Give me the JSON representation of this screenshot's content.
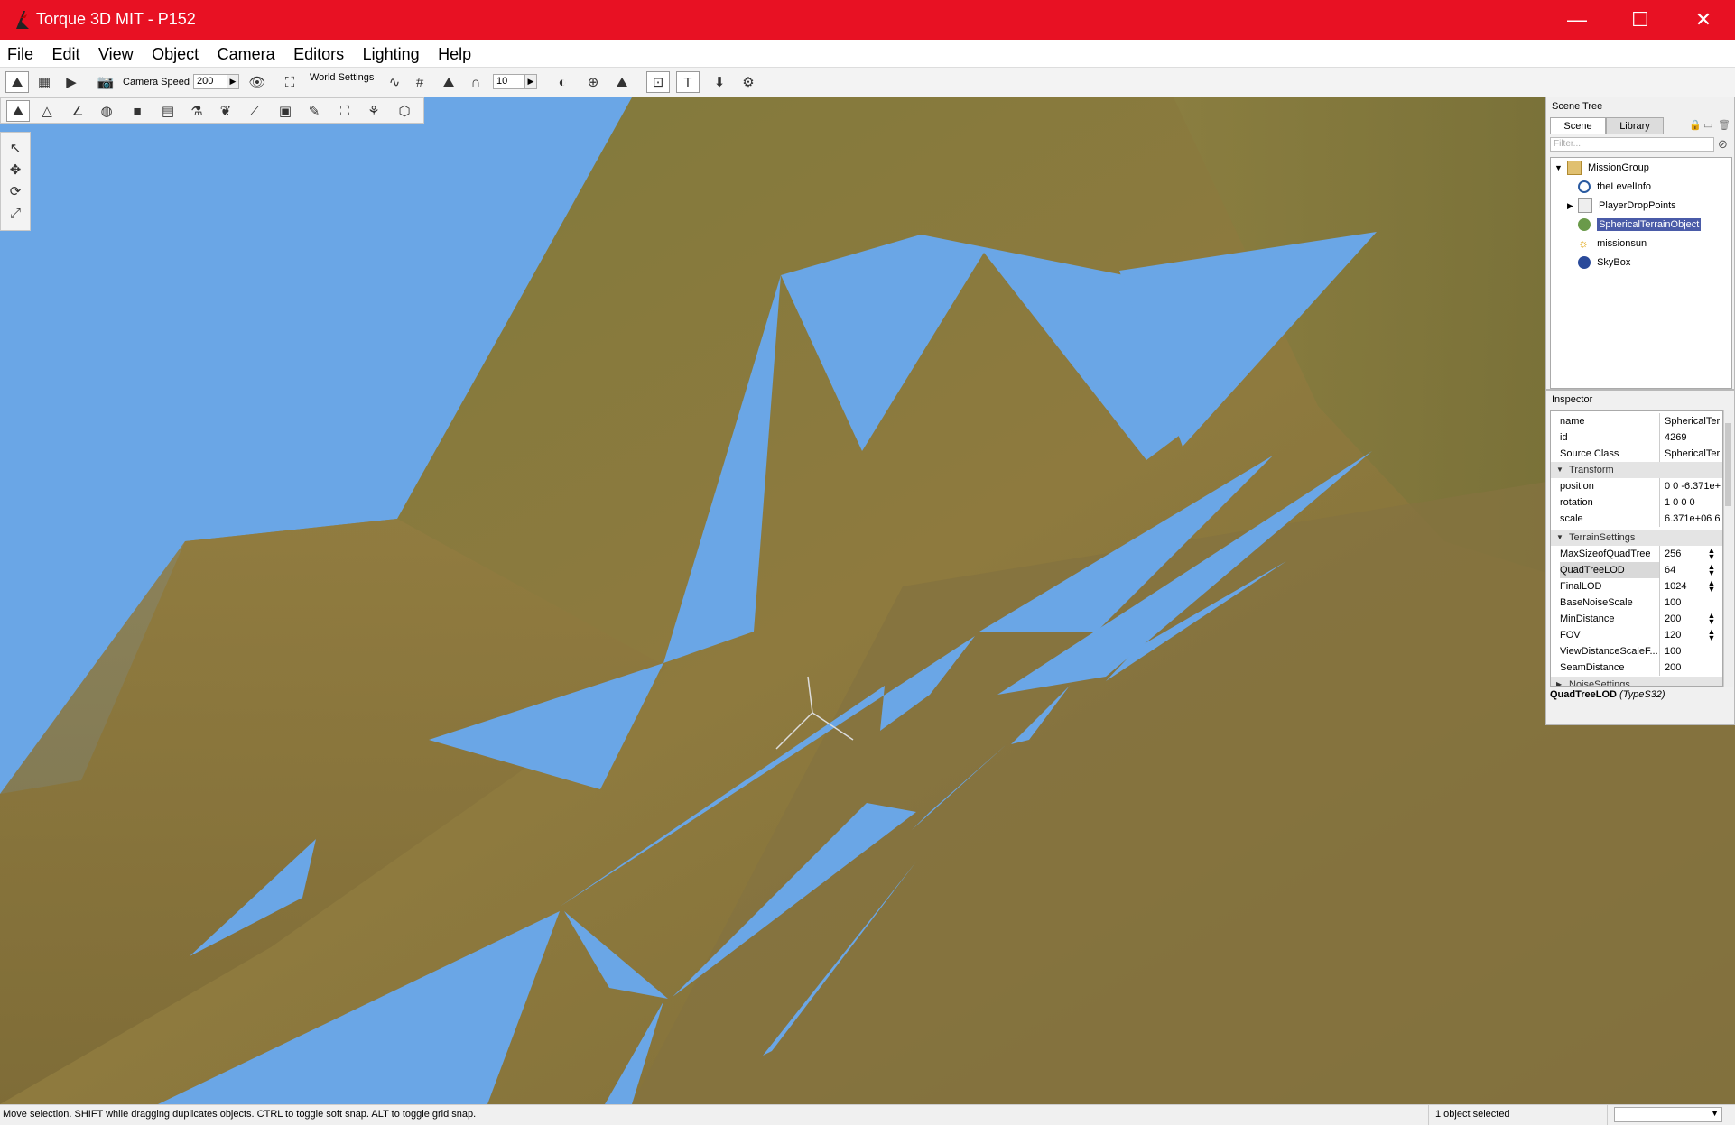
{
  "window": {
    "title": "Torque 3D MIT - P152",
    "controls": {
      "minimize": "—",
      "maximize": "☐",
      "close": "✕"
    },
    "accent": "#e81123"
  },
  "menu": [
    "File",
    "Edit",
    "View",
    "Object",
    "Camera",
    "Editors",
    "Lighting",
    "Help"
  ],
  "toolbar": {
    "camera_speed_label": "Camera Speed",
    "camera_speed_value": "200",
    "world_settings_label": "World Settings",
    "grid_size_value": "10"
  },
  "scene_tree": {
    "header": "Scene Tree",
    "tabs": [
      "Scene",
      "Library"
    ],
    "filter_placeholder": "Filter...",
    "items": [
      {
        "label": "MissionGroup",
        "icon": "folder-open-icon"
      },
      {
        "label": "theLevelInfo",
        "icon": "info-icon"
      },
      {
        "label": "PlayerDropPoints",
        "icon": "folder-icon"
      },
      {
        "label": "SphericalTerrainObject",
        "icon": "terrain-icon"
      },
      {
        "label": "missionsun",
        "icon": "sun-icon"
      },
      {
        "label": "SkyBox",
        "icon": "skybox-icon"
      }
    ]
  },
  "inspector": {
    "header": "Inspector",
    "rows": [
      {
        "key": "name",
        "value": "SphericalTer"
      },
      {
        "key": "id",
        "value": "4269"
      },
      {
        "key": "Source Class",
        "value": "SphericalTer"
      },
      {
        "key": "Transform",
        "value": ""
      },
      {
        "key": "position",
        "value": "0 0 -6.371e+"
      },
      {
        "key": "rotation",
        "value": "1 0 0 0"
      },
      {
        "key": "scale",
        "value": "6.371e+06 6."
      },
      {
        "key": "TerrainSettings",
        "value": ""
      },
      {
        "key": "MaxSizeofQuadTree",
        "value": "256"
      },
      {
        "key": "QuadTreeLOD",
        "value": "64"
      },
      {
        "key": "FinalLOD",
        "value": "1024"
      },
      {
        "key": "BaseNoiseScale",
        "value": "100"
      },
      {
        "key": "MinDistance",
        "value": "200"
      },
      {
        "key": "FOV",
        "value": "120"
      },
      {
        "key": "ViewDistanceScaleF...",
        "value": "100"
      },
      {
        "key": "SeamDistance",
        "value": "200"
      },
      {
        "key": "NoiseSettings",
        "value": ""
      }
    ],
    "help_field": "QuadTreeLOD",
    "help_type": "(TypeS32)"
  },
  "statusbar": {
    "message": "Move selection.  SHIFT while dragging duplicates objects.  CTRL to toggle soft snap.  ALT to toggle grid snap.",
    "selection": "1 object selected"
  },
  "colors": {
    "sky": "#6aa6e6",
    "terrain": "#8a7a3a",
    "selection": "#4a5ba8"
  }
}
